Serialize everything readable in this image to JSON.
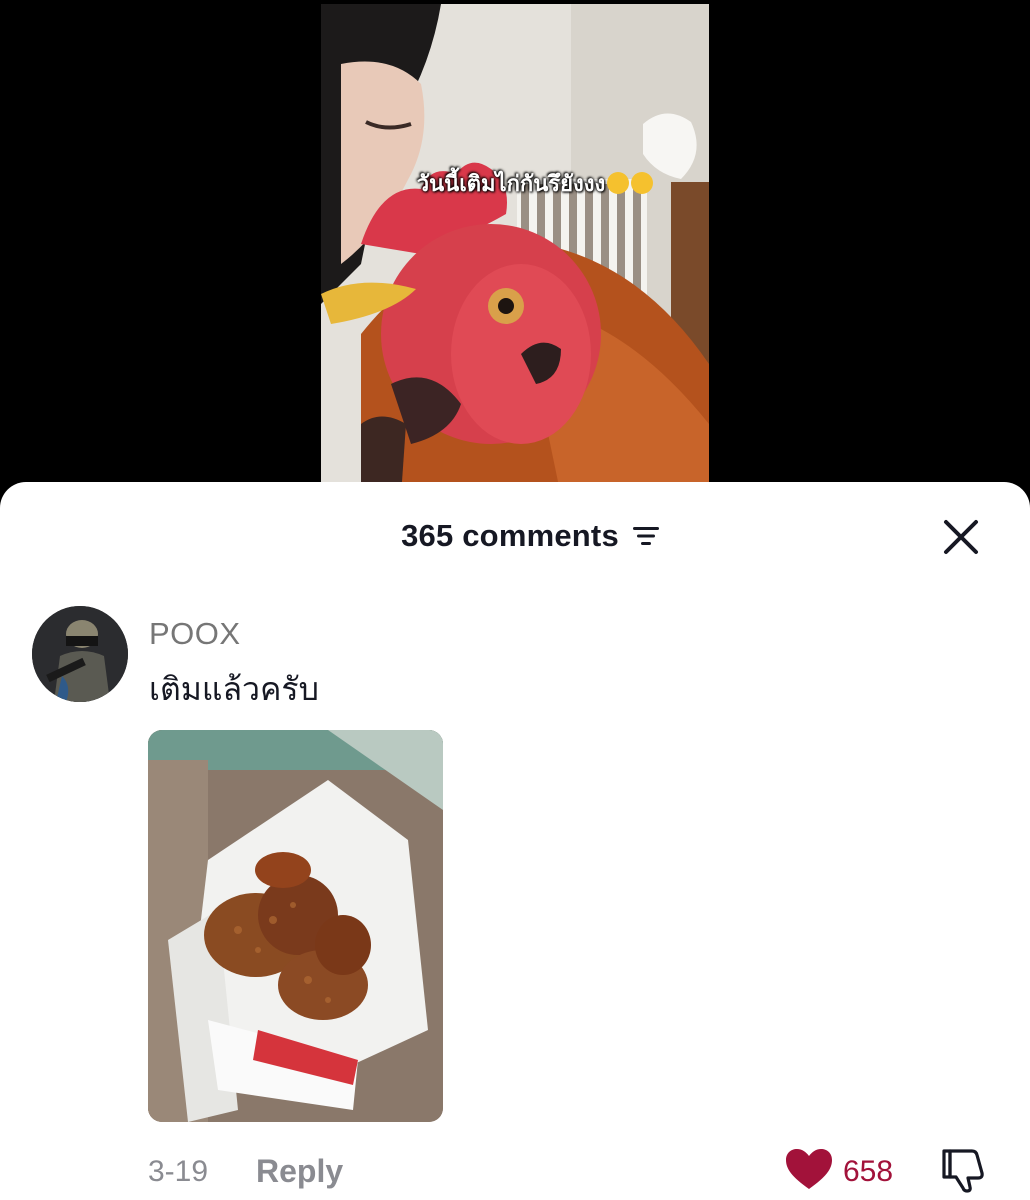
{
  "video": {
    "caption": "วันนี้เติมไก่กันรึยังงง",
    "caption_emojis": [
      "winking-face-icon",
      "heart-eyes-face-icon"
    ]
  },
  "comments_panel": {
    "count_label": "365 comments",
    "sort_icon": "sort-lines-icon",
    "close_icon": "close-icon"
  },
  "comment": {
    "username": "POOX",
    "text": "เติมแล้วครับ",
    "date": "3-19",
    "reply_label": "Reply",
    "likes": "658",
    "liked": true,
    "like_color": "#a2123a"
  }
}
